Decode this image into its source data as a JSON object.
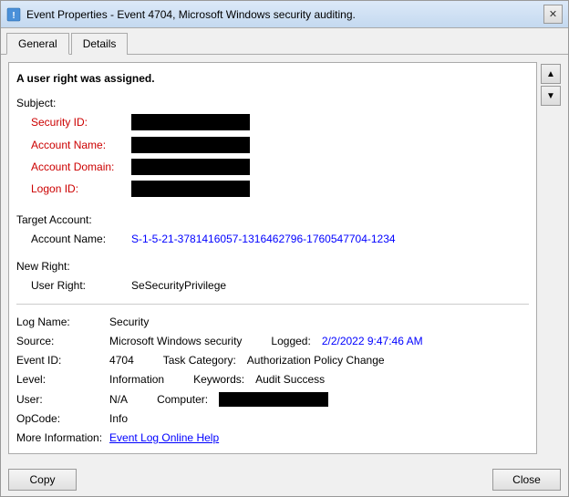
{
  "window": {
    "title": "Event Properties - Event 4704, Microsoft Windows security auditing.",
    "close_label": "✕"
  },
  "tabs": [
    {
      "label": "General",
      "active": true
    },
    {
      "label": "Details",
      "active": false
    }
  ],
  "event_content": {
    "intro": "A user right was assigned.",
    "subject_header": "Subject:",
    "security_id_label": "Security ID:",
    "account_name_label": "Account Name:",
    "account_domain_label": "Account Domain:",
    "logon_id_label": "Logon ID:",
    "target_account_header": "Target Account:",
    "target_account_name_label": "Account Name:",
    "target_account_name_value": "S-1-5-21-3781416057-1316462796-1760547704-1234",
    "new_right_header": "New Right:",
    "user_right_label": "User Right:",
    "user_right_value": "SeSecurityPrivilege"
  },
  "meta": {
    "log_name_label": "Log Name:",
    "log_name_value": "Security",
    "source_label": "Source:",
    "source_value": "Microsoft Windows security",
    "logged_label": "Logged:",
    "logged_value": "2/2/2022 9:47:46 AM",
    "event_id_label": "Event ID:",
    "event_id_value": "4704",
    "task_category_label": "Task Category:",
    "task_category_value": "Authorization Policy Change",
    "level_label": "Level:",
    "level_value": "Information",
    "keywords_label": "Keywords:",
    "keywords_value": "Audit Success",
    "user_label": "User:",
    "user_value": "N/A",
    "computer_label": "Computer:",
    "opcode_label": "OpCode:",
    "opcode_value": "Info",
    "more_info_label": "More Information:",
    "more_info_link": "Event Log Online Help"
  },
  "footer": {
    "copy_label": "Copy",
    "close_label": "Close"
  },
  "scroll": {
    "up_arrow": "▲",
    "down_arrow": "▼"
  }
}
